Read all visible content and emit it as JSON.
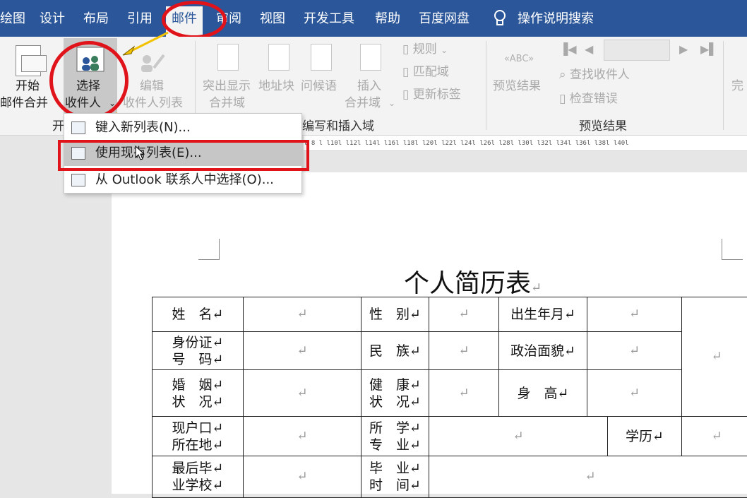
{
  "tabs": [
    "绘图",
    "设计",
    "布局",
    "引用",
    "邮件",
    "审阅",
    "视图",
    "开发工具",
    "帮助",
    "百度网盘"
  ],
  "search_label": "操作说明搜索",
  "ribbon": {
    "start_merge": [
      "开始",
      "邮件合并"
    ],
    "select_recipients": [
      "选择",
      "收件人"
    ],
    "edit_list": [
      "编辑",
      "收件人列表"
    ],
    "highlight": [
      "突出显示",
      "合并域"
    ],
    "address_block": "地址块",
    "greeting": "问候语",
    "insert_field": [
      "插入",
      "合并域"
    ],
    "rules": "规则",
    "match_fields": "匹配域",
    "update_labels": "更新标签",
    "preview": "预览结果",
    "find_recipient": "查找收件人",
    "check_errors": "检查错误",
    "finish": "完",
    "group_start": "开",
    "group_write": "编写和插入域",
    "group_preview": "预览结果"
  },
  "ruler_text": "l 8 l  l10l  l12l  l14l  l16l  l18l  l20l  l22l  l24l  l26l  l28l  l30l  l32l  l34l  l36l  l38l  l40l",
  "menu": [
    {
      "label": "键入新列表(N)..."
    },
    {
      "label": "使用现有列表(E)..."
    },
    {
      "label": "从 Outlook 联系人中选择(O)..."
    }
  ],
  "doc": {
    "title": "个人简历表",
    "ret": "↵",
    "cells": {
      "name": "姓　名↵",
      "gender": "性　别↵",
      "birth": "出生年月↵",
      "idcard": "身份证↵\n号　码↵",
      "nation": "民　族↵",
      "political": "政治面貌↵",
      "marriage": "婚　姻↵\n状　况↵",
      "health": "健　康↵\n状　况↵",
      "height": "身　高↵",
      "hukou": "现户口↵\n所在地↵",
      "major": "所　学↵\n专　业↵",
      "education": "学历↵",
      "school": "最后毕↵\n业学校↵",
      "gradtime": "毕　业↵\n时　间↵",
      "empty": "↵"
    }
  }
}
